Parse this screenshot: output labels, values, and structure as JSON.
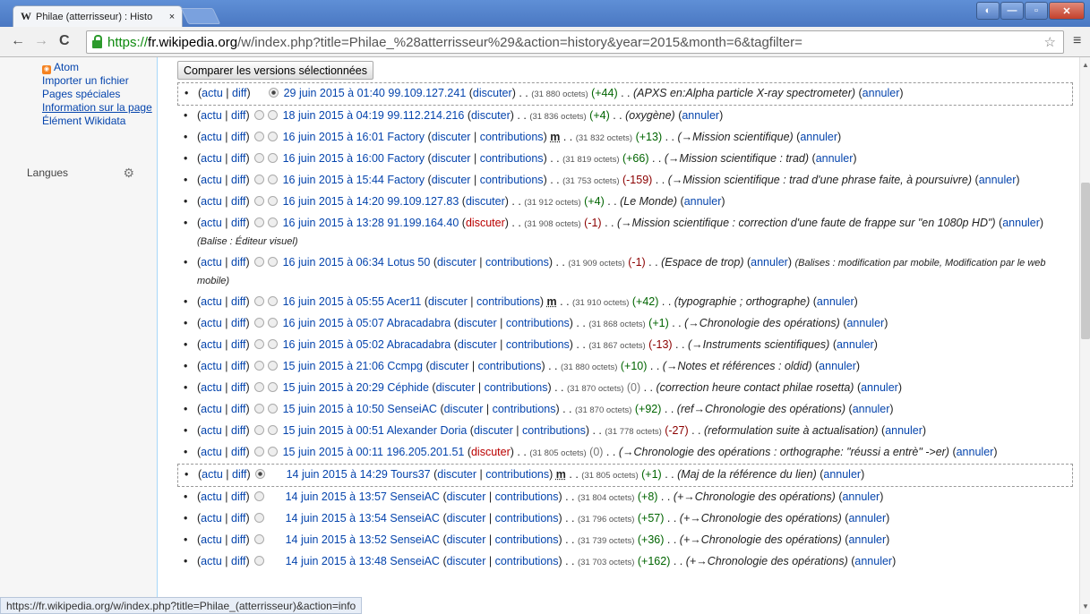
{
  "browser": {
    "tab_title": "Philae (atterrisseur) : Histo",
    "tab_close": "×",
    "url_https": "https://",
    "url_host": "fr.wikipedia.org",
    "url_rest": "/w/index.php?title=Philae_%28atterrisseur%29&action=history&year=2015&month=6&tagfilter=",
    "status_url": "https://fr.wikipedia.org/w/index.php?title=Philae_(atterrisseur)&action=info"
  },
  "sidebar": {
    "items": [
      "Atom",
      "Importer un fichier",
      "Pages spéciales",
      "Information sur la page",
      "Élément Wikidata"
    ],
    "languages_label": "Langues"
  },
  "main": {
    "compare_button": "Comparer les versions sélectionnées",
    "labels": {
      "actu": "actu",
      "diff": "diff",
      "discuter": "discuter",
      "contributions": "contributions",
      "annuler": "annuler",
      "minor": "m"
    },
    "rows": [
      {
        "date": "29 juin 2015 à 01:40",
        "user": "99.109.127.241",
        "anon": true,
        "size": "(31 880 octets)",
        "delta": "(+44)",
        "dclass": "pos",
        "summary": "(APXS en:Alpha particle X-ray spectrometer)",
        "sel": true,
        "r1": "hid",
        "r2": "on"
      },
      {
        "date": "18 juin 2015 à 04:19",
        "user": "99.112.214.216",
        "anon": true,
        "size": "(31 836 octets)",
        "delta": "(+4)",
        "dclass": "pos",
        "summary": "(oxygène)"
      },
      {
        "date": "16 juin 2015 à 16:01",
        "user": "Factory",
        "minor": true,
        "size": "(31 832 octets)",
        "delta": "(+13)",
        "dclass": "pos",
        "summary": "(→Mission scientifique)"
      },
      {
        "date": "16 juin 2015 à 16:00",
        "user": "Factory",
        "size": "(31 819 octets)",
        "delta": "(+66)",
        "dclass": "pos",
        "summary": "(→Mission scientifique : trad)"
      },
      {
        "date": "16 juin 2015 à 15:44",
        "user": "Factory",
        "size": "(31 753 octets)",
        "delta": "(-159)",
        "dclass": "neg",
        "summary": "(→Mission scientifique : trad d'une phrase faite, à poursuivre)"
      },
      {
        "date": "16 juin 2015 à 14:20",
        "user": "99.109.127.83",
        "anon": true,
        "size": "(31 912 octets)",
        "delta": "(+4)",
        "dclass": "pos",
        "summary": "(Le Monde)"
      },
      {
        "date": "16 juin 2015 à 13:28",
        "user": "91.199.164.40",
        "anon": true,
        "redtalk": true,
        "size": "(31 908 octets)",
        "delta": "(-1)",
        "dclass": "neg",
        "summary": "(→Mission scientifique : correction d'une faute de frappe sur \"en 1080p HD\")",
        "tag": "(Balise : Éditeur visuel)"
      },
      {
        "date": "16 juin 2015 à 06:34",
        "user": "Lotus 50",
        "size": "(31 909 octets)",
        "delta": "(-1)",
        "dclass": "neg",
        "summary": "(Espace de trop)",
        "tag": "(Balises : modification par mobile, Modification par le web mobile)"
      },
      {
        "date": "16 juin 2015 à 05:55",
        "user": "Acer11",
        "minor": true,
        "size": "(31 910 octets)",
        "delta": "(+42)",
        "dclass": "pos",
        "summary": "(typographie ; orthographe)"
      },
      {
        "date": "16 juin 2015 à 05:07",
        "user": "Abracadabra",
        "size": "(31 868 octets)",
        "delta": "(+1)",
        "dclass": "pos",
        "summary": "(→Chronologie des opérations)"
      },
      {
        "date": "16 juin 2015 à 05:02",
        "user": "Abracadabra",
        "size": "(31 867 octets)",
        "delta": "(-13)",
        "dclass": "neg",
        "summary": "(→Instruments scientifiques)"
      },
      {
        "date": "15 juin 2015 à 21:06",
        "user": "Ccmpg",
        "size": "(31 880 octets)",
        "delta": "(+10)",
        "dclass": "pos",
        "summary": "(→Notes et références : oldid)"
      },
      {
        "date": "15 juin 2015 à 20:29",
        "user": "Céphide",
        "size": "(31 870 octets)",
        "delta": "(0)",
        "dclass": "zero",
        "summary": "(correction heure contact philae rosetta)"
      },
      {
        "date": "15 juin 2015 à 10:50",
        "user": "SenseiAC",
        "size": "(31 870 octets)",
        "delta": "(+92)",
        "dclass": "pos",
        "summary": "(ref→Chronologie des opérations)"
      },
      {
        "date": "15 juin 2015 à 00:51",
        "user": "Alexander Doria",
        "size": "(31 778 octets)",
        "delta": "(-27)",
        "dclass": "neg",
        "summary": "(reformulation suite à actualisation)"
      },
      {
        "date": "15 juin 2015 à 00:11",
        "user": "196.205.201.51",
        "anon": true,
        "redtalk": true,
        "size": "(31 805 octets)",
        "delta": "(0)",
        "dclass": "zero",
        "summary": "(→Chronologie des opérations : orthographe: \"réussi a entrè\" ->er)"
      },
      {
        "date": "14 juin 2015 à 14:29",
        "user": "Tours37",
        "minor": true,
        "size": "(31 805 octets)",
        "delta": "(+1)",
        "dclass": "pos",
        "summary": "(Maj de la référence du lien)",
        "sel": true,
        "r1": "on",
        "r2": "none"
      },
      {
        "date": "14 juin 2015 à 13:57",
        "user": "SenseiAC",
        "size": "(31 804 octets)",
        "delta": "(+8)",
        "dclass": "pos",
        "summary": "(+→Chronologie des opérations)",
        "r2": "none"
      },
      {
        "date": "14 juin 2015 à 13:54",
        "user": "SenseiAC",
        "size": "(31 796 octets)",
        "delta": "(+57)",
        "dclass": "pos",
        "summary": "(+→Chronologie des opérations)",
        "r2": "none"
      },
      {
        "date": "14 juin 2015 à 13:52",
        "user": "SenseiAC",
        "size": "(31 739 octets)",
        "delta": "(+36)",
        "dclass": "pos",
        "summary": "(+→Chronologie des opérations)",
        "r2": "none"
      },
      {
        "date": "14 juin 2015 à 13:48",
        "user": "SenseiAC",
        "size": "(31 703 octets)",
        "delta": "(+162)",
        "dclass": "pos",
        "summary": "(+→Chronologie des opérations)",
        "r2": "none"
      }
    ]
  }
}
